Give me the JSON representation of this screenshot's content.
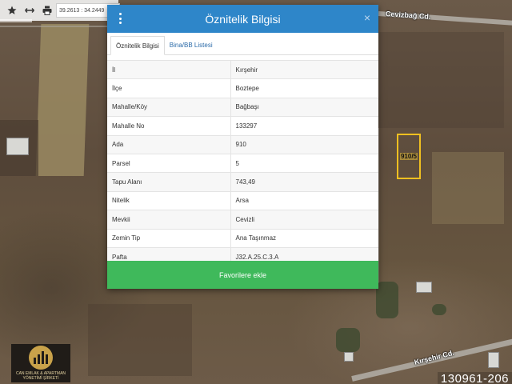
{
  "toolbar": {
    "coordinates": "39.2613 : 34.2449",
    "icons": [
      "star-icon",
      "resize-icon",
      "print-icon"
    ]
  },
  "map": {
    "street_top": "Cevizbağ Cd.",
    "street_bottom": "Kırşehir Cd.",
    "parcel_label": "910/5"
  },
  "modal": {
    "title": "Öznitelik Bilgisi",
    "close_glyph": "×",
    "tabs": [
      {
        "label": "Öznitelik Bilgisi",
        "active": true
      },
      {
        "label": "Bina/BB Listesi",
        "active": false
      }
    ],
    "rows": [
      {
        "key": "İl",
        "value": "Kırşehir"
      },
      {
        "key": "İlçe",
        "value": "Boztepe"
      },
      {
        "key": "Mahalle/Köy",
        "value": "Bağbaşı"
      },
      {
        "key": "Mahalle No",
        "value": "133297"
      },
      {
        "key": "Ada",
        "value": "910"
      },
      {
        "key": "Parsel",
        "value": "5"
      },
      {
        "key": "Tapu Alanı",
        "value": "743,49"
      },
      {
        "key": "Nitelik",
        "value": "Arsa"
      },
      {
        "key": "Mevkii",
        "value": "Cevizli"
      },
      {
        "key": "Zemin Tip",
        "value": "Ana Taşınmaz"
      },
      {
        "key": "Pafta",
        "value": "J32.A.25.C.3.A"
      }
    ],
    "favorite_button": "Favorilere ekle"
  },
  "logo": {
    "text_line1": "CAN EMLAK & APARTMAN",
    "text_line2": "YÖNETİMİ ŞİRKETİ"
  },
  "listing_number": "130961-206",
  "colors": {
    "header_blue": "#2e86c9",
    "button_green": "#3fb95b",
    "parcel_outline": "#f0c020"
  }
}
